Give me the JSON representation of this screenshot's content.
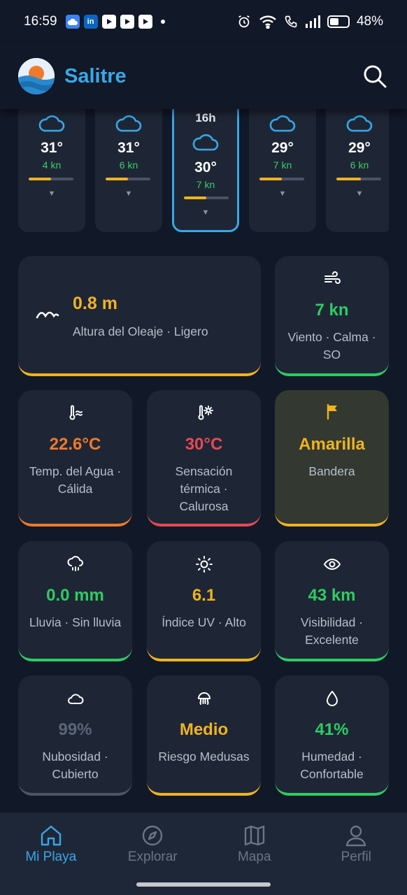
{
  "status_bar": {
    "time": "16:59",
    "battery": "48%",
    "battery_level": 0.48,
    "apps": [
      "cloud-icon",
      "linkedin-icon",
      "youtube-icon",
      "youtube-icon",
      "youtube-icon"
    ]
  },
  "header": {
    "title": "Salitre",
    "logo": "sun-over-sea-logo",
    "search_icon": "search-icon"
  },
  "hourly": [
    {
      "label": "",
      "temp": "31°",
      "wind": "4 kn",
      "wind_fraction": 0.5,
      "icon": "cloud-icon",
      "selected": false
    },
    {
      "label": "",
      "temp": "31°",
      "wind": "6 kn",
      "wind_fraction": 0.5,
      "icon": "cloud-icon",
      "selected": false
    },
    {
      "label": "16h",
      "temp": "30°",
      "wind": "7 kn",
      "wind_fraction": 0.5,
      "icon": "cloud-icon",
      "selected": true
    },
    {
      "label": "",
      "temp": "29°",
      "wind": "7 kn",
      "wind_fraction": 0.5,
      "icon": "cloud-icon",
      "selected": false
    },
    {
      "label": "",
      "temp": "29°",
      "wind": "6 kn",
      "wind_fraction": 0.55,
      "icon": "cloud-icon",
      "selected": false
    }
  ],
  "cards": {
    "waves": {
      "value": "0.8 m",
      "label": "Altura del Oleaje · Ligero",
      "color": "#f0b320",
      "icon": "waves-icon"
    },
    "wind": {
      "value": "7 kn",
      "label": "Viento · Calma · SO",
      "color": "#2ecc62",
      "icon": "wind-icon"
    },
    "water_temp": {
      "value": "22.6°C",
      "label": "Temp. del Agua · Cálida",
      "color": "#f07a2c",
      "icon": "water-thermometer-icon"
    },
    "feels_like": {
      "value": "30°C",
      "label": "Sensación térmica · Calurosa",
      "color": "#e84855",
      "icon": "sun-thermometer-icon"
    },
    "flag": {
      "value": "Amarilla",
      "label": "Bandera",
      "color": "#f0b320",
      "icon": "flag-icon"
    },
    "rain": {
      "value": "0.0 mm",
      "label": "Lluvia · Sin lluvia",
      "color": "#2ecc62",
      "icon": "cloud-rain-icon"
    },
    "uv": {
      "value": "6.1",
      "label": "Índice UV · Alto",
      "color": "#f0b320",
      "icon": "sun-icon"
    },
    "visibility": {
      "value": "43 km",
      "label": "Visibilidad · Excelente",
      "color": "#2ecc62",
      "icon": "eye-icon"
    },
    "clouds": {
      "value": "99%",
      "label": "Nubosidad · Cubierto",
      "color": "#5b6577",
      "icon": "cloud-icon"
    },
    "jellyfish": {
      "value": "Medio",
      "label": "Riesgo Medusas",
      "color": "#f0b320",
      "icon": "jellyfish-icon"
    },
    "humidity": {
      "value": "41%",
      "label": "Humedad · Confortable",
      "color": "#2ecc62",
      "icon": "droplet-icon"
    }
  },
  "nav": [
    {
      "label": "Mi Playa",
      "icon": "home-icon",
      "active": true
    },
    {
      "label": "Explorar",
      "icon": "compass-icon",
      "active": false
    },
    {
      "label": "Mapa",
      "icon": "map-icon",
      "active": false
    },
    {
      "label": "Perfil",
      "icon": "user-icon",
      "active": false
    }
  ],
  "colors": {
    "accent": "#3aa7e6",
    "background": "#111827",
    "card": "#1e2635",
    "yellow": "#f0b320",
    "green": "#2ecc62",
    "orange": "#f07a2c",
    "red": "#e84855"
  }
}
